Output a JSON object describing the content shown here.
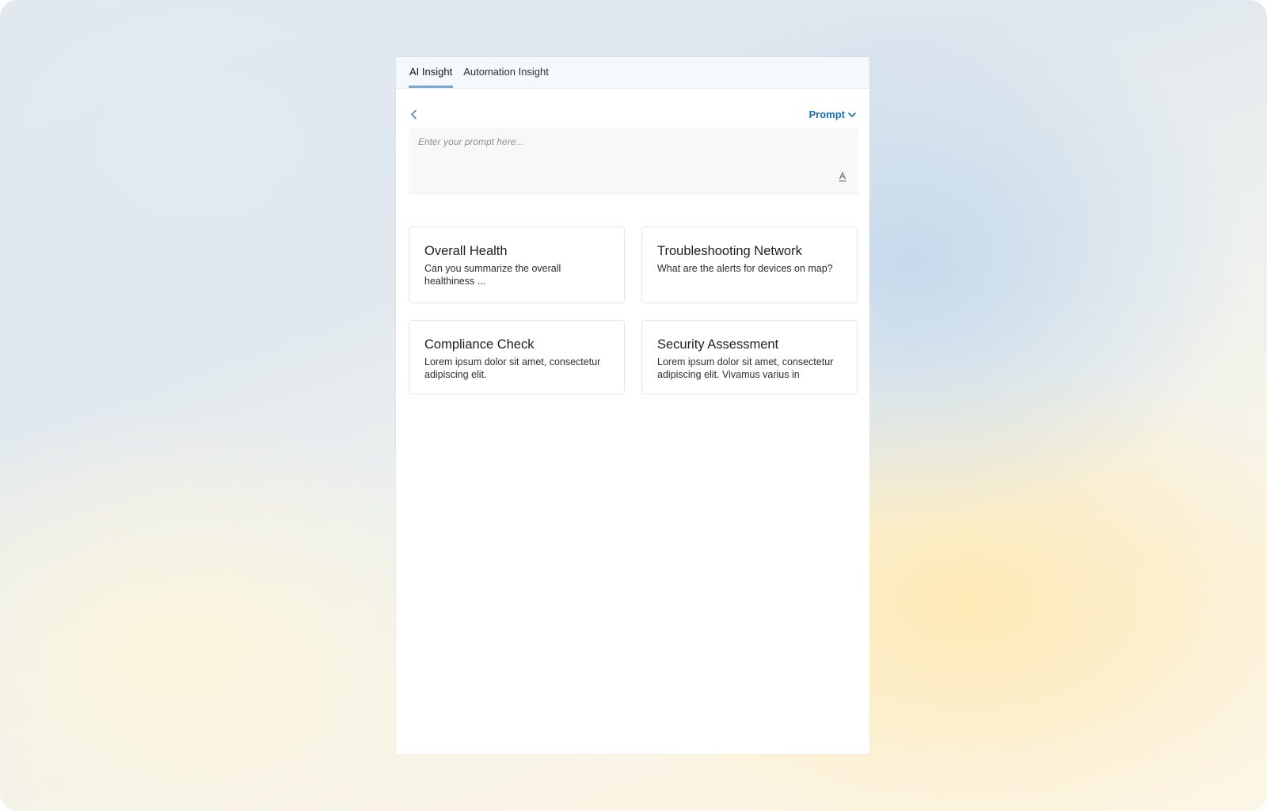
{
  "tabs": [
    {
      "label": "AI Insight",
      "active": true
    },
    {
      "label": "Automation Insight",
      "active": false
    }
  ],
  "toolbar": {
    "back_icon": "chevron-left-icon",
    "prompt_label": "Prompt",
    "prompt_icon": "chevron-down-icon"
  },
  "prompt_input": {
    "value": "",
    "placeholder": "Enter your prompt here...",
    "format_icon": "text-format-icon"
  },
  "cards": [
    {
      "title": "Overall Health",
      "description": "Can you summarize the overall healthiness ..."
    },
    {
      "title": "Troubleshooting Network",
      "description": "What are the alerts for devices on map?"
    },
    {
      "title": "Compliance Check",
      "description": "Lorem ipsum dolor sit amet, consectetur adipiscing elit."
    },
    {
      "title": "Security Assessment",
      "description": "Lorem ipsum dolor sit amet, consectetur adipiscing elit. Vivamus varius in"
    }
  ],
  "colors": {
    "accent": "#1a6fb0",
    "tab_indicator": "#79a8d6"
  }
}
